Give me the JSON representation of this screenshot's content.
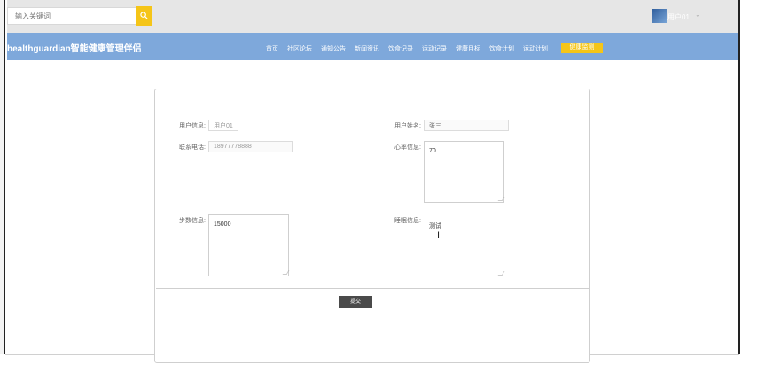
{
  "search": {
    "placeholder": "输入关键词"
  },
  "user": {
    "name": "用户01",
    "caret": "⌄"
  },
  "brand": "healthguardian智能健康管理伴侣",
  "nav": {
    "items": [
      "首页",
      "社区论坛",
      "通知公告",
      "新闻资讯",
      "饮食记录",
      "运动记录",
      "健康目标",
      "饮食计划",
      "运动计划"
    ],
    "active": "健康监测"
  },
  "form": {
    "user_account": {
      "label": "用户信息:",
      "value": "用户01"
    },
    "user_name": {
      "label": "用户姓名:",
      "value": "张三"
    },
    "phone": {
      "label": "联系电话:",
      "value": "18977778888"
    },
    "heart_rate": {
      "label": "心率信息:",
      "value": "70"
    },
    "steps": {
      "label": "步数信息:",
      "value": "15000"
    },
    "sleep": {
      "label": "睡眠信息:",
      "value": "测试"
    },
    "submit_label": "提交"
  },
  "colors": {
    "nav_bg": "#7ea8db",
    "accent": "#f5c518",
    "topbar_bg": "#e6e6e6"
  }
}
